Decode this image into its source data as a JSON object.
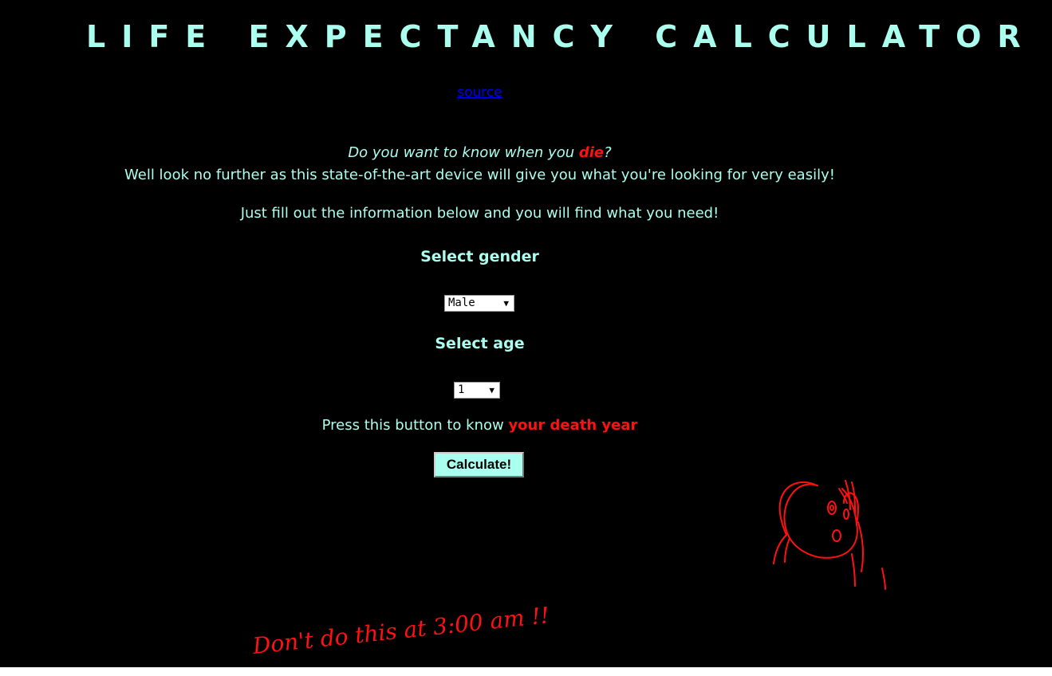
{
  "header": {
    "title": "LIFE EXPECTANCY CALCULATOR",
    "source_link": "source"
  },
  "intro": {
    "question_before": "Do you want to know when you ",
    "question_highlight": "die",
    "question_after": "?",
    "line2": "Well look no further as this state-of-the-art device will give you what you're looking for very easily!",
    "line3": "Just fill out the information below and you will find what you need!"
  },
  "form": {
    "gender_label": "Select gender",
    "gender_value": "Male",
    "age_label": "Select age",
    "age_value": "1",
    "press_text": "Press this button to know ",
    "press_highlight": "your death year",
    "calculate_label": "Calculate!"
  },
  "footer": {
    "handwritten_note": "Don't do this at 3:00 am !!"
  },
  "colors": {
    "background": "#000000",
    "text_accent": "#aaffee",
    "highlight": "#ff1111",
    "link": "#0000ee"
  }
}
